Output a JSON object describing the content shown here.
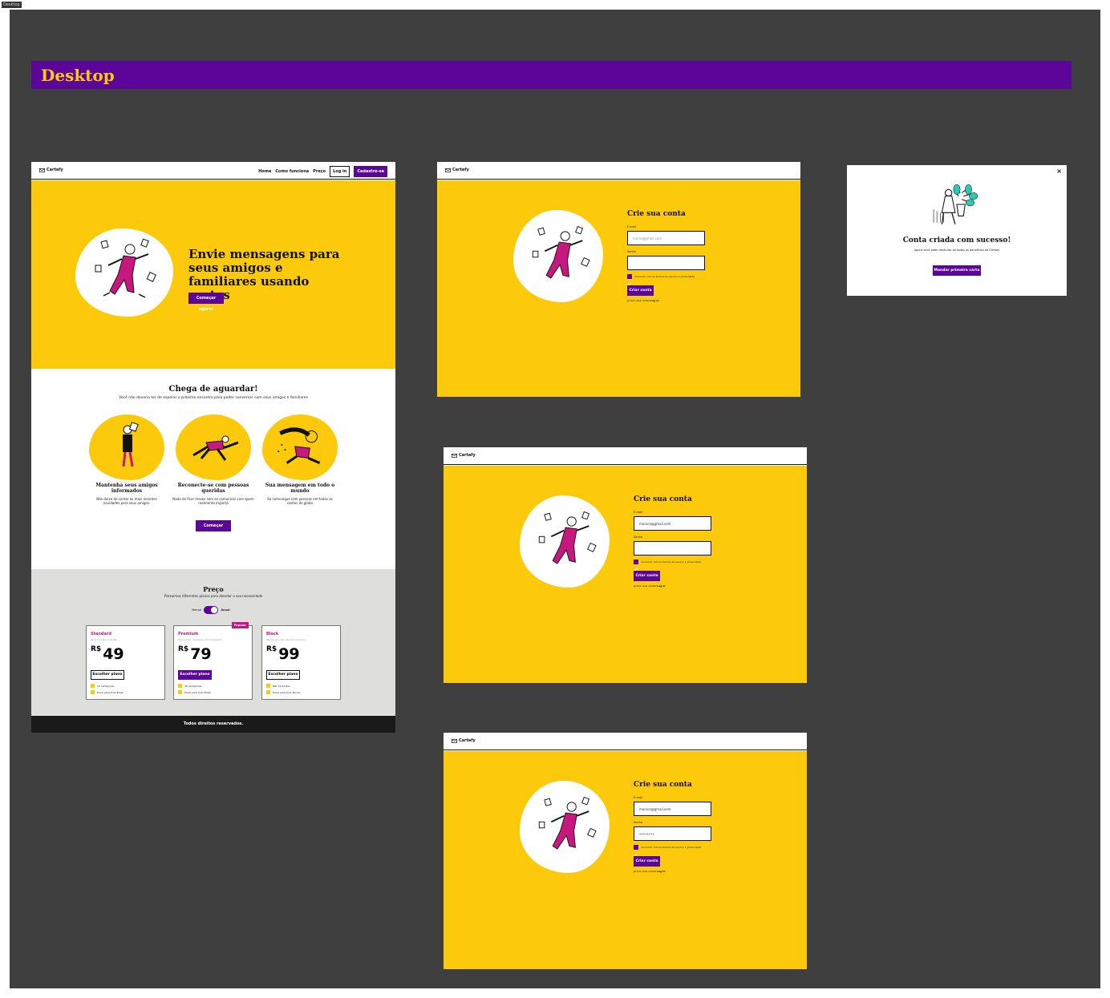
{
  "corner_tag": "Desktop",
  "banner_title": "Desktop",
  "brand": "Cartafy",
  "colors": {
    "purple": "#5b0698",
    "yellow": "#fcc90b",
    "magenta": "#c7187f",
    "dark": "#1a1a1a",
    "gray": "#dededd"
  },
  "nav": {
    "home": "Home",
    "how": "Como funciona",
    "price": "Preço",
    "login": "Log in",
    "signup": "Cadastre-se"
  },
  "hero": {
    "title": "Envie mensagens para seus amigos e familiares usando cartas",
    "cta": "Começar agora!"
  },
  "features": {
    "title": "Chega de aguardar!",
    "subtitle": "Você não deveria ter de esperar o próximo encontro para poder conversar com seus amigos e familiares",
    "items": [
      {
        "title": "Mantenha seus amigos informados",
        "text": "Não deixe de contar as mais recentes novidades para seus amigos."
      },
      {
        "title": "Reconecte-se com pessoas queridas",
        "text": "Nada de ficar meses sem se comunicar com quem realmente importa"
      },
      {
        "title": "Sua mensagem em todo o mundo",
        "text": "Se comunique com pessoas em todos os cantos do globo"
      }
    ],
    "cta": "Começar agora!"
  },
  "pricing": {
    "title": "Preço",
    "subtitle": "Possuímos diferentes planos para atender a sua necessidade",
    "toggle_left": "Mensal",
    "toggle_right": "Anual",
    "plans": [
      {
        "name": "Standard",
        "desc": "Para os mais pontuais",
        "currency": "R$",
        "price": "49",
        "button": "Escolher plano",
        "f1": "10 cartas/mês",
        "f2": "Envio para todo Brasil",
        "badge": ""
      },
      {
        "name": "Premium",
        "desc": "Para quem conversa com frequência",
        "currency": "R$",
        "price": "79",
        "button": "Escolher plano",
        "f1": "30 cartas/mês",
        "f2": "Envio para todo Brasil",
        "badge": "Popular"
      },
      {
        "name": "Black",
        "desc": "Para quem não para de escrever",
        "currency": "R$",
        "price": "99",
        "button": "Escolher plano",
        "f1": "Não há limites",
        "f2": "Envio para todo Mundo",
        "badge": ""
      }
    ]
  },
  "footer": "Todos direitos reservados.",
  "signup": {
    "title": "Crie sua conta",
    "email_label": "E-mail",
    "email_placeholder": "nome@gmail.com",
    "email_value": "monica@gmail.com",
    "password_label": "Senha",
    "password_value": "••••••••",
    "terms": "Concordo com os termos de serviço e privacidade",
    "submit": "Criar conta",
    "have_account": "Já tem uma conta?",
    "login": "Log in"
  },
  "modal": {
    "title": "Conta criada com sucesso!",
    "text": "Agora você pode desfrutar de todos os benefícios do Cartafy",
    "button": "Mandar primeira carta",
    "close": "×"
  }
}
